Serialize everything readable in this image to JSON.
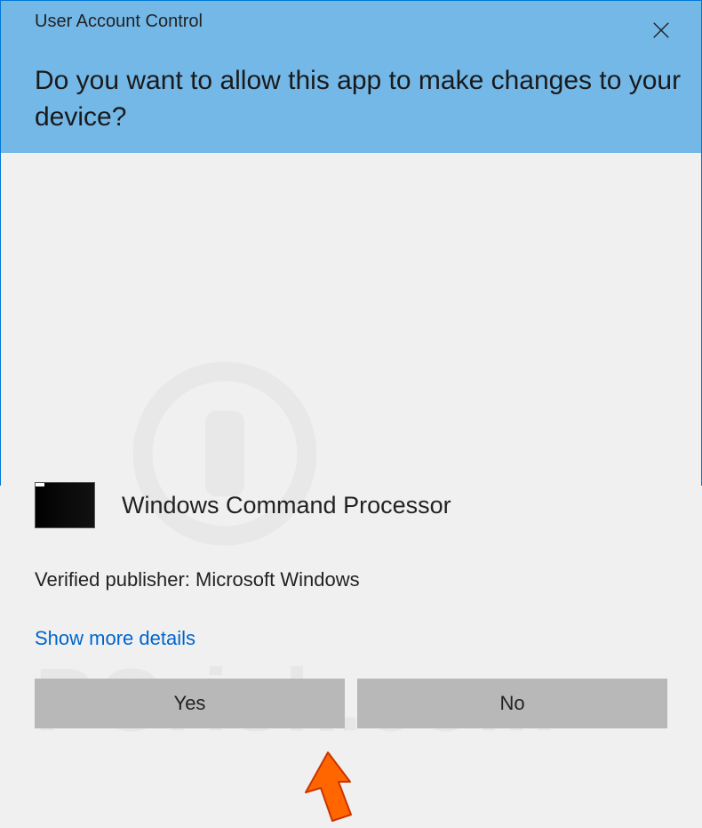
{
  "dialog": {
    "title": "User Account Control",
    "prompt": "Do you want to allow this app to make changes to your device?",
    "app_name": "Windows Command Processor",
    "publisher_label": "Verified publisher: Microsoft Windows",
    "details_link": "Show more details",
    "yes_button": "Yes",
    "no_button": "No"
  }
}
